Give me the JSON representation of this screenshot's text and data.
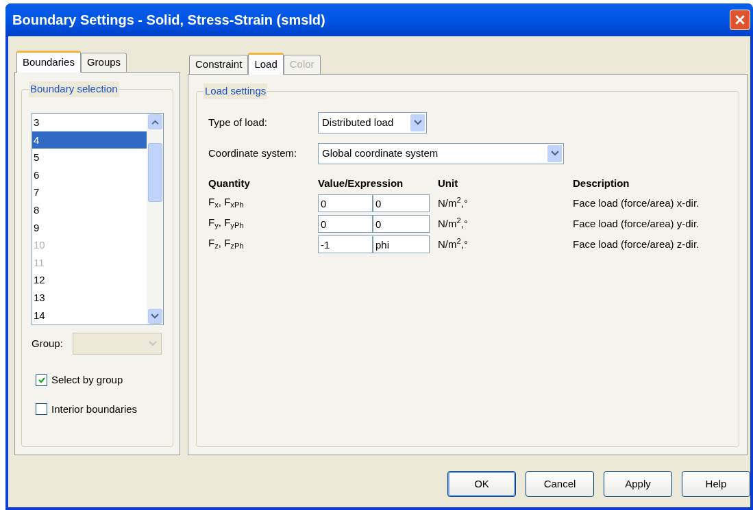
{
  "window": {
    "title": "Boundary Settings - Solid, Stress-Strain (smsld)"
  },
  "left_tabs": [
    {
      "label": "Boundaries",
      "selected": true
    },
    {
      "label": "Groups",
      "selected": false
    }
  ],
  "boundary_selection": {
    "title": "Boundary selection",
    "items": [
      {
        "label": "3",
        "selected": false,
        "disabled": false
      },
      {
        "label": "4",
        "selected": true,
        "disabled": false
      },
      {
        "label": "5",
        "selected": false,
        "disabled": false
      },
      {
        "label": "6",
        "selected": false,
        "disabled": false
      },
      {
        "label": "7",
        "selected": false,
        "disabled": false
      },
      {
        "label": "8",
        "selected": false,
        "disabled": false
      },
      {
        "label": "9",
        "selected": false,
        "disabled": false
      },
      {
        "label": "10",
        "selected": false,
        "disabled": true
      },
      {
        "label": "11",
        "selected": false,
        "disabled": true
      },
      {
        "label": "12",
        "selected": false,
        "disabled": false
      },
      {
        "label": "13",
        "selected": false,
        "disabled": false
      },
      {
        "label": "14",
        "selected": false,
        "disabled": false
      }
    ],
    "group_label": "Group:",
    "checkboxes": [
      {
        "label": "Select by group",
        "checked": true
      },
      {
        "label": "Interior boundaries",
        "checked": false
      }
    ]
  },
  "right_tabs": [
    {
      "label": "Constraint",
      "selected": false,
      "disabled": false
    },
    {
      "label": "Load",
      "selected": true,
      "disabled": false
    },
    {
      "label": "Color",
      "selected": false,
      "disabled": true
    }
  ],
  "load_settings": {
    "title": "Load settings",
    "type_of_load": {
      "label": "Type of load:",
      "value": "Distributed load"
    },
    "coordinate_system": {
      "label": "Coordinate system:",
      "value": "Global coordinate system"
    },
    "columns": [
      "Quantity",
      "Value/Expression",
      "Unit",
      "Description"
    ],
    "rows": [
      {
        "quantity": "F$_{x}$, F$_{xPh}$",
        "value": "0",
        "phase": "0",
        "unit": "N/m$^{2}$,°",
        "description": "Face load (force/area) x-dir."
      },
      {
        "quantity": "F$_{y}$, F$_{yPh}$",
        "value": "0",
        "phase": "0",
        "unit": "N/m$^{2}$,°",
        "description": "Face load (force/area) y-dir."
      },
      {
        "quantity": "F$_{z}$, F$_{zPh}$",
        "value": "-1",
        "phase": "phi",
        "unit": "N/m$^{2}$,°",
        "description": "Face load (force/area) z-dir."
      }
    ]
  },
  "buttons": [
    {
      "label": "OK",
      "default": true
    },
    {
      "label": "Cancel",
      "default": false
    },
    {
      "label": "Apply",
      "default": false
    },
    {
      "label": "Help",
      "default": false
    }
  ]
}
